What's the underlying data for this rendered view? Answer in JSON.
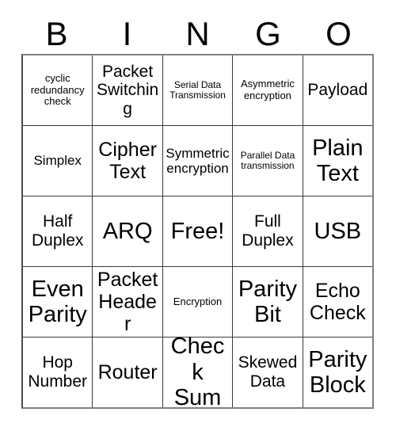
{
  "header": {
    "letters": [
      "B",
      "I",
      "N",
      "G",
      "O"
    ]
  },
  "grid": {
    "rows": [
      {
        "cells": [
          {
            "text": "cyclic redundancy check",
            "size": "fs-sm"
          },
          {
            "text": "Packet Switching",
            "size": "fs-lg"
          },
          {
            "text": "Serial Data Transmission",
            "size": "fs-xs"
          },
          {
            "text": "Asymmetric encryption",
            "size": "fs-sm"
          },
          {
            "text": "Payload",
            "size": "fs-lg"
          }
        ]
      },
      {
        "cells": [
          {
            "text": "Simplex",
            "size": "fs-md"
          },
          {
            "text": "Cipher Text",
            "size": "fs-xl"
          },
          {
            "text": "Symmetric encryption",
            "size": "fs-md"
          },
          {
            "text": "Parallel Data transmission",
            "size": "fs-xs"
          },
          {
            "text": "Plain Text",
            "size": "fs-xxl"
          }
        ]
      },
      {
        "cells": [
          {
            "text": "Half Duplex",
            "size": "fs-lg"
          },
          {
            "text": "ARQ",
            "size": "fs-xxl"
          },
          {
            "text": "Free!",
            "size": "fs-xxl"
          },
          {
            "text": "Full Duplex",
            "size": "fs-lg"
          },
          {
            "text": "USB",
            "size": "fs-xxl"
          }
        ]
      },
      {
        "cells": [
          {
            "text": "Even Parity",
            "size": "fs-xxl"
          },
          {
            "text": "Packet Header",
            "size": "fs-xl"
          },
          {
            "text": "Encryption",
            "size": "fs-sm"
          },
          {
            "text": "Parity Bit",
            "size": "fs-xxl"
          },
          {
            "text": "Echo Check",
            "size": "fs-xl"
          }
        ]
      },
      {
        "cells": [
          {
            "text": "Hop Number",
            "size": "fs-lg"
          },
          {
            "text": "Router",
            "size": "fs-xl"
          },
          {
            "text": "Check Sum",
            "size": "fs-xxl"
          },
          {
            "text": "Skewed Data",
            "size": "fs-lg"
          },
          {
            "text": "Parity Block",
            "size": "fs-xxl"
          }
        ]
      }
    ]
  },
  "colors": {
    "background": "#ffffff",
    "text": "#000000",
    "grid_line": "#3a3a3a",
    "outer_border": "#808080"
  }
}
